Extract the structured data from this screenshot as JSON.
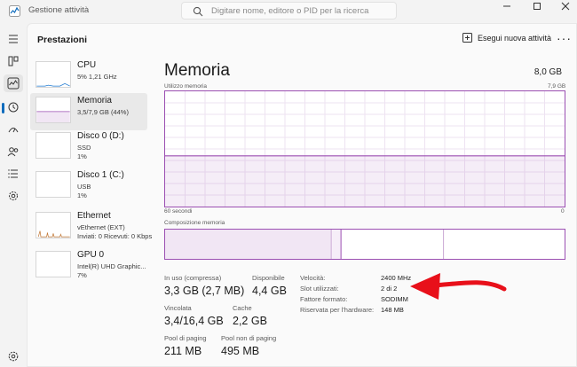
{
  "window": {
    "title": "Gestione attività"
  },
  "search": {
    "placeholder": "Digitare nome, editore o PID per la ricerca"
  },
  "header": {
    "title": "Prestazioni",
    "run_task_label": "Esegui nuova attività",
    "more_label": "···"
  },
  "resources": [
    {
      "name": "CPU",
      "sub1": "5% 1,21 GHz",
      "sub2": ""
    },
    {
      "name": "Memoria",
      "sub1": "3,5/7,9 GB (44%)",
      "sub2": ""
    },
    {
      "name": "Disco 0 (D:)",
      "sub1": "SSD",
      "sub2": "1%"
    },
    {
      "name": "Disco 1 (C:)",
      "sub1": "USB",
      "sub2": "1%"
    },
    {
      "name": "Ethernet",
      "sub1": "vEthernet (EXT)",
      "sub2": "Inviati: 0 Ricevuti: 0 Kbps"
    },
    {
      "name": "GPU 0",
      "sub1": "Intel(R) UHD Graphic...",
      "sub2": "7%"
    }
  ],
  "detail": {
    "title": "Memoria",
    "total": "8,0 GB",
    "usage_label": "Utilizzo memoria",
    "usage_max": "7,9 GB",
    "time_left": "60 secondi",
    "time_right": "0",
    "composition_label": "Composizione memoria",
    "usage_fraction": 0.44
  },
  "stats": {
    "in_use_label": "In uso (compressa)",
    "in_use_value": "3,3 GB (2,7 MB)",
    "available_label": "Disponibile",
    "available_value": "4,4 GB",
    "committed_label": "Vincolata",
    "committed_value": "3,4/16,4 GB",
    "cache_label": "Cache",
    "cache_value": "2,2 GB",
    "paged_label": "Pool di paging",
    "paged_value": "211 MB",
    "nonpaged_label": "Pool non di paging",
    "nonpaged_value": "495 MB"
  },
  "hardware": {
    "speed_label": "Velocità:",
    "speed_value": "2400 MHz",
    "slots_label": "Slot utilizzati:",
    "slots_value": "2 di 2",
    "form_label": "Fattore formato:",
    "form_value": "SODIMM",
    "reserved_label": "Riservata per l'hardware:",
    "reserved_value": "148 MB"
  },
  "colors": {
    "accent": "#0f6cbd",
    "memory": "#9b4fb2",
    "memory_fill": "#f1e6f4",
    "annotation": "#e8101a"
  }
}
